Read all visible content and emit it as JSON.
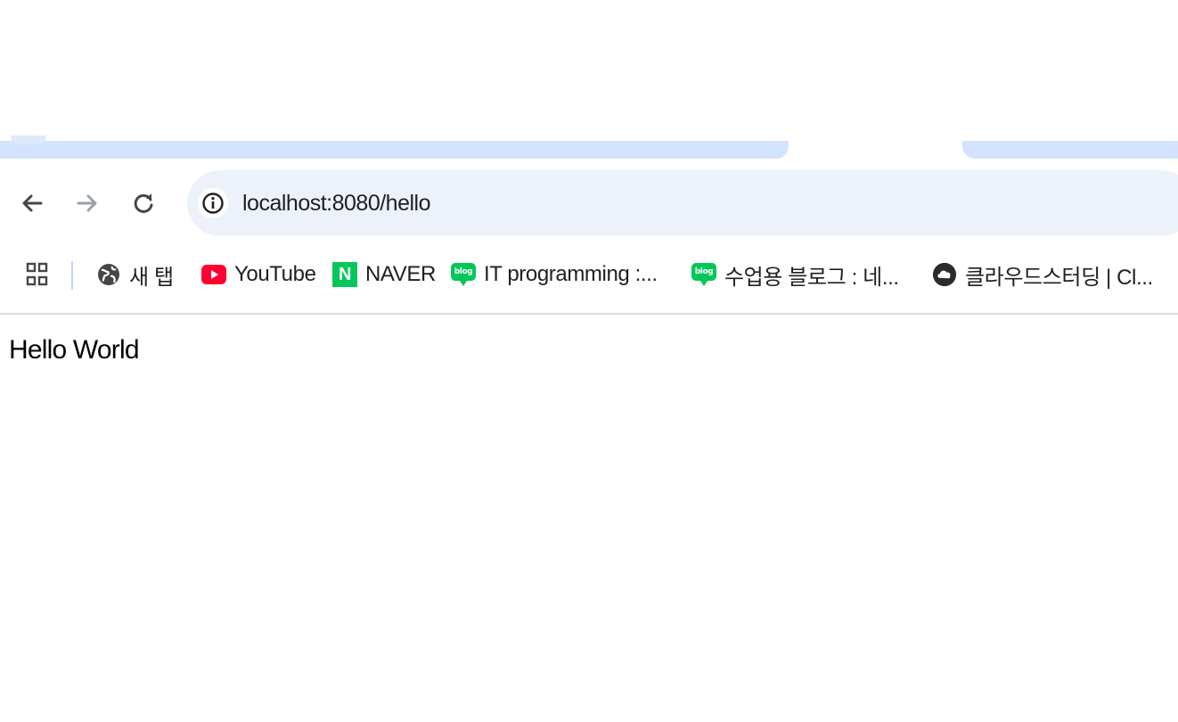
{
  "browser": {
    "address_bar": {
      "url": "localhost:8080/hello"
    },
    "bookmarks": [
      {
        "label": "새 탭",
        "icon": "globe-icon"
      },
      {
        "label": "YouTube",
        "icon": "youtube-icon",
        "color": "#ff0033"
      },
      {
        "label": "NAVER",
        "icon": "naver-icon",
        "color": "#03c75a"
      },
      {
        "label": "IT programming :...",
        "icon": "blog-icon",
        "color": "#03c75a"
      },
      {
        "label": "수업용 블로그 : 네...",
        "icon": "blog-icon",
        "color": "#03c75a"
      },
      {
        "label": "클라우드스터딩 | Cl...",
        "icon": "cloud-icon"
      }
    ],
    "blog_icon_text": "blog",
    "naver_icon_text": "N"
  },
  "page": {
    "body_text": "Hello World"
  },
  "colors": {
    "tabstrip": "#d3e3fd",
    "omnibox": "#edf2fa",
    "icon": "#444746",
    "forward_disabled": "#9aa0a6"
  }
}
